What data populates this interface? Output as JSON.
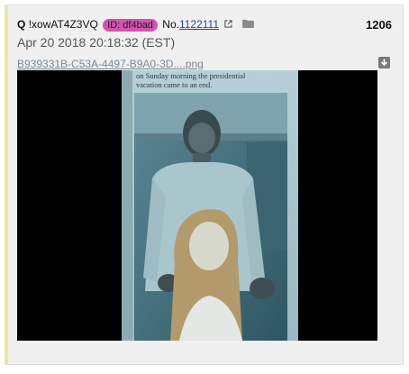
{
  "post": {
    "author": "Q",
    "tripcode": "!xowAT4Z3VQ",
    "id_badge": "ID: df4bad",
    "number_label": "No.",
    "number": "1122111",
    "index": "1206",
    "timestamp": "Apr 20 2018 20:18:32 (EST)",
    "file_name": "B939331B-C53A-4497-B9A0-3D....png",
    "image_caption": "on Sunday morning the presidential vacation came to an end.",
    "colors": {
      "id_badge": "#d552b0",
      "link": "#2d3fb3",
      "border_accent": "#e9e9a0"
    }
  },
  "icons": {
    "external_link": "external-link-icon",
    "folder": "folder-icon",
    "download": "download-icon"
  }
}
